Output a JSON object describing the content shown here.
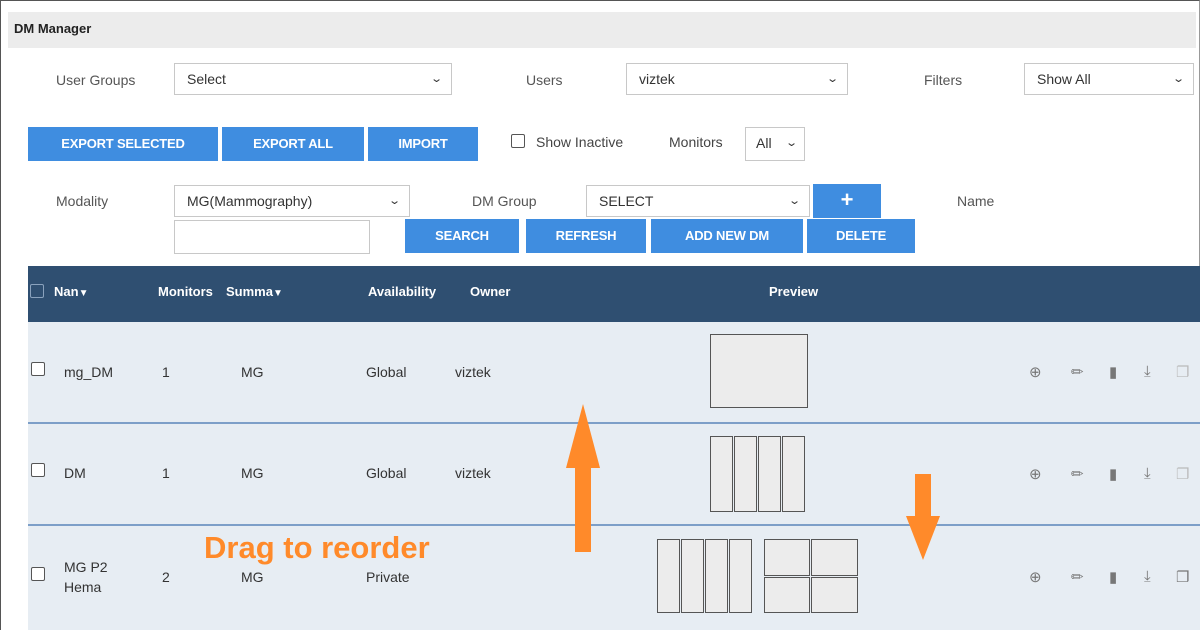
{
  "title": "DM Manager",
  "filters": {
    "user_groups_label": "User Groups",
    "user_groups_value": "Select",
    "users_label": "Users",
    "users_value": "viztek",
    "filters_label": "Filters",
    "filters_value": "Show All"
  },
  "toolbar": {
    "export_selected": "EXPORT SELECTED",
    "export_all": "EXPORT ALL",
    "import": "IMPORT",
    "show_inactive": "Show Inactive",
    "monitors_label": "Monitors",
    "monitors_value": "All"
  },
  "search": {
    "modality_label": "Modality",
    "modality_value": "MG(Mammography)",
    "dm_group_label": "DM Group",
    "dm_group_value": "SELECT",
    "add_group": "+",
    "name_label": "Name",
    "name_value": "",
    "search": "SEARCH",
    "refresh": "REFRESH",
    "add_new_dm": "ADD NEW DM",
    "delete": "DELETE"
  },
  "table": {
    "headers": {
      "name": "Nan",
      "monitors": "Monitors",
      "summary": "Summa",
      "availability": "Availability",
      "owner": "Owner",
      "preview": "Preview"
    },
    "rows": [
      {
        "name": "mg_DM",
        "monitors": "1",
        "summary": "MG",
        "availability": "Global",
        "owner": "viztek"
      },
      {
        "name": "DM",
        "monitors": "1",
        "summary": "MG",
        "availability": "Global",
        "owner": "viztek"
      },
      {
        "name": "MG P2 Hema",
        "monitors": "2",
        "summary": "MG",
        "availability": "Private",
        "owner": ""
      }
    ]
  },
  "overlay": {
    "text": "Drag to reorder",
    "color": "#ff8a2a"
  },
  "colors": {
    "button": "#3f8de0",
    "header": "#2f4f71",
    "row": "#e7edf3"
  }
}
